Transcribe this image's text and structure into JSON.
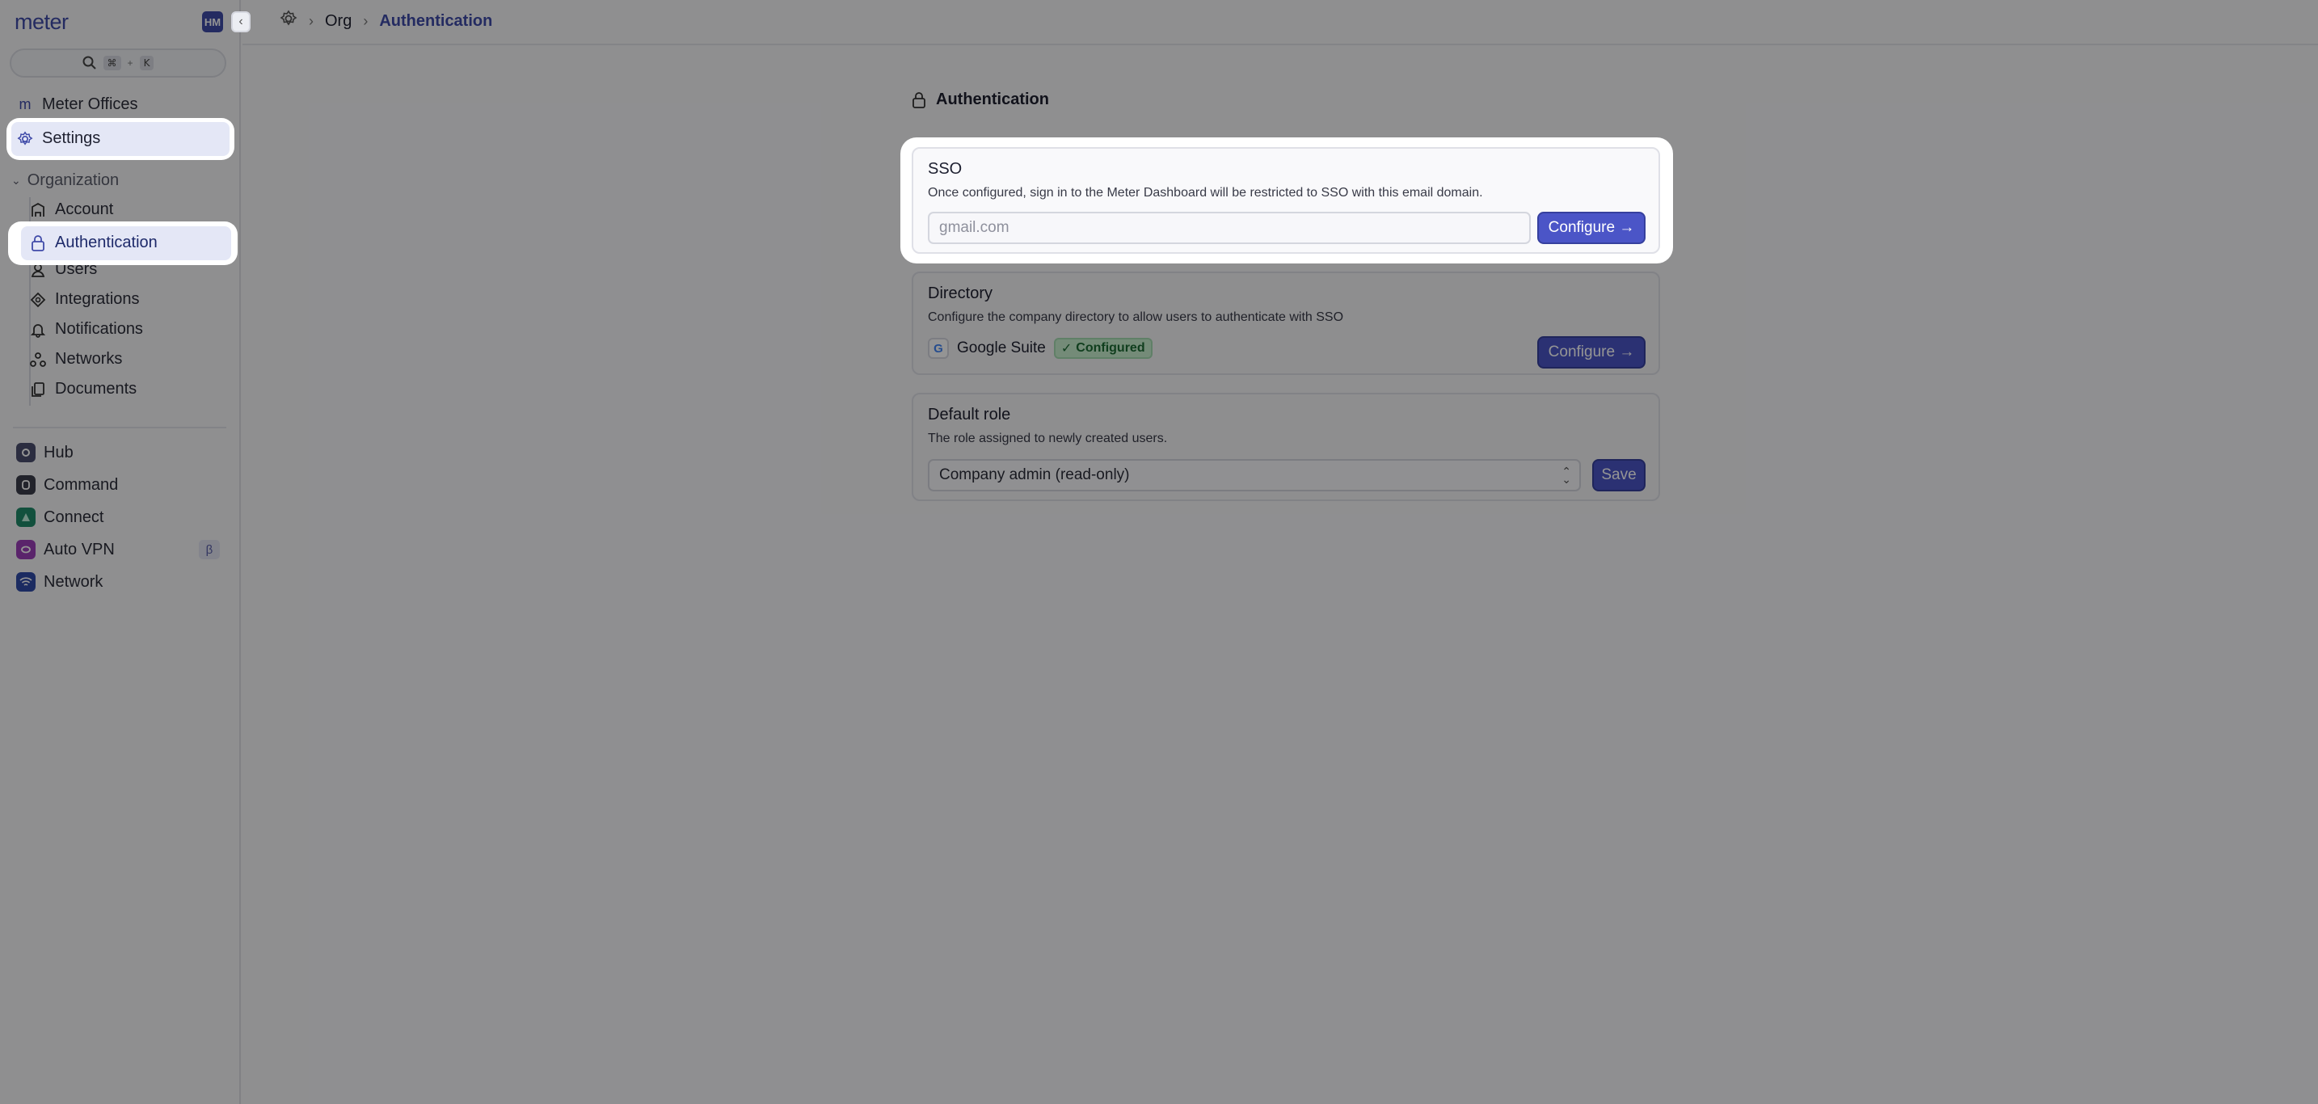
{
  "app": {
    "logo": "meter",
    "avatar_initials": "HM"
  },
  "search": {
    "kbd_cmd": "⌘",
    "kbd_plus": "+",
    "kbd_key": "K"
  },
  "sidebar": {
    "org_name": "Meter Offices",
    "settings_label": "Settings",
    "group_label": "Organization",
    "items": [
      {
        "label": "Account",
        "icon": "building-icon"
      },
      {
        "label": "Authentication",
        "icon": "lock-icon"
      },
      {
        "label": "Users",
        "icon": "user-icon"
      },
      {
        "label": "Integrations",
        "icon": "integration-icon"
      },
      {
        "label": "Notifications",
        "icon": "bell-icon"
      },
      {
        "label": "Networks",
        "icon": "networks-icon"
      },
      {
        "label": "Documents",
        "icon": "documents-icon"
      }
    ],
    "apps": [
      {
        "label": "Hub",
        "color": "#4a4f6e"
      },
      {
        "label": "Command",
        "color": "#3b3d4a"
      },
      {
        "label": "Connect",
        "color": "#1f8a6a"
      },
      {
        "label": "Auto VPN",
        "color": "#9b3fb8",
        "badge": "β"
      },
      {
        "label": "Network",
        "color": "#2f4aa8"
      }
    ]
  },
  "breadcrumb": {
    "org": "Org",
    "current": "Authentication"
  },
  "page": {
    "title": "Authentication"
  },
  "sso": {
    "title": "SSO",
    "description": "Once configured, sign in to the Meter Dashboard will be restricted to SSO with this email domain.",
    "placeholder": "gmail.com",
    "button": "Configure →"
  },
  "directory": {
    "title": "Directory",
    "description": "Configure the company directory to allow users to authenticate with SSO",
    "provider": "Google Suite",
    "status": "Configured",
    "button": "Configure →"
  },
  "default_role": {
    "title": "Default role",
    "description": "The role assigned to newly created users.",
    "selected": "Company admin (read-only)",
    "button": "Save"
  },
  "colors": {
    "accent": "#4b55c7",
    "success": "#1d6b34"
  }
}
